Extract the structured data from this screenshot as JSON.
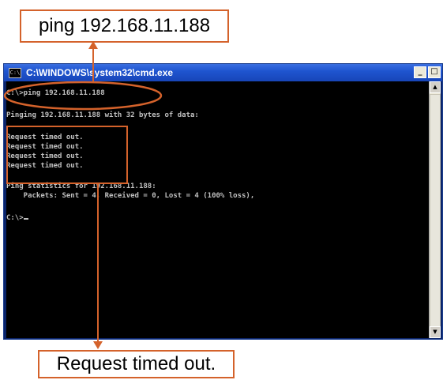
{
  "callouts": {
    "top_text": "ping  192.168.11.188",
    "bottom_text": "Request timed out."
  },
  "window": {
    "title": "C:\\WINDOWS\\system32\\cmd.exe",
    "buttons": {
      "minimize": "_",
      "maximize": "□"
    }
  },
  "console": {
    "lines": [
      "C:\\>ping 192.168.11.188",
      "",
      "Pinging 192.168.11.188 with 32 bytes of data:",
      "",
      "Request timed out.",
      "Request timed out.",
      "Request timed out.",
      "Request timed out.",
      "",
      "Ping statistics for 192.168.11.188:",
      "    Packets: Sent = 4, Received = 0, Lost = 4 (100% loss),",
      "",
      "C:\\>"
    ]
  },
  "colors": {
    "annotation": "#d4622b",
    "console_bg": "#000000",
    "console_text": "#c0c0c0",
    "titlebar": "#1f55d0"
  }
}
